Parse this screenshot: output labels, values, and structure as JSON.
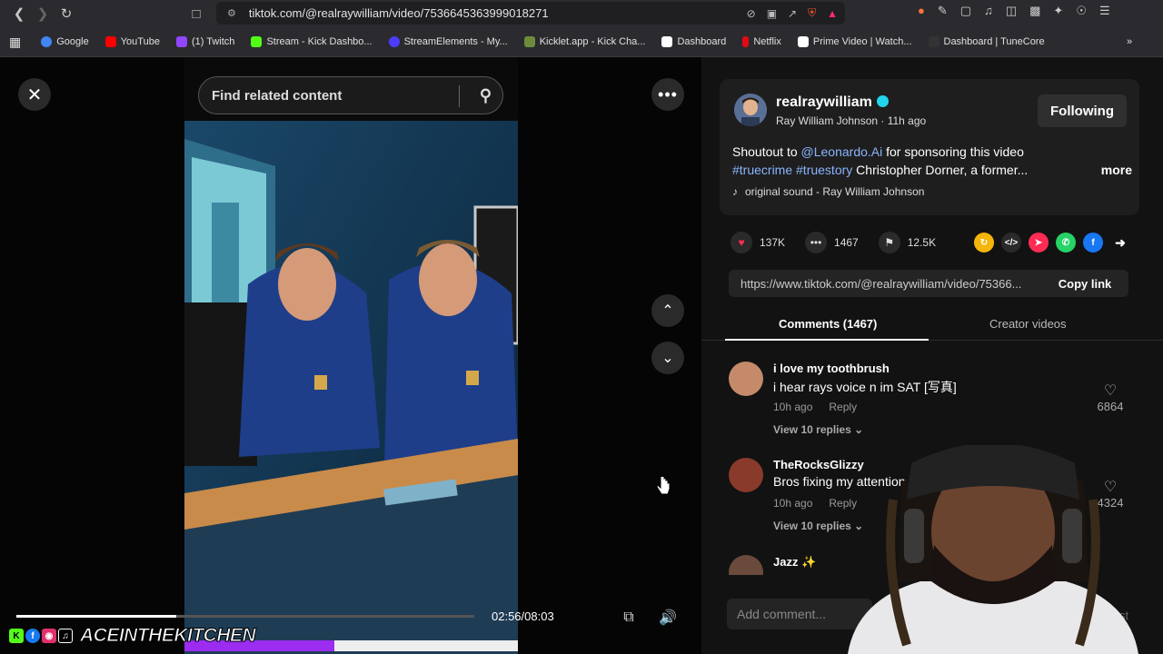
{
  "browser": {
    "url": "tiktok.com/@realraywilliam/video/7536645363999018271",
    "bookmarks": [
      {
        "label": "Google",
        "color": "#4285f4"
      },
      {
        "label": "YouTube",
        "color": "#ff0000"
      },
      {
        "label": "(1) Twitch",
        "color": "#9146ff"
      },
      {
        "label": "Stream - Kick Dashbo...",
        "color": "#53fc18"
      },
      {
        "label": "StreamElements - My...",
        "color": "#4b3cff"
      },
      {
        "label": "Kicklet.app - Kick Cha...",
        "color": "#6c8c3c"
      },
      {
        "label": "Dashboard",
        "color": "#ffffff"
      },
      {
        "label": "Netflix",
        "color": "#e50914"
      },
      {
        "label": "Prime Video | Watch...",
        "color": "#ffffff"
      },
      {
        "label": "Dashboard | TuneCore",
        "color": "#333333"
      }
    ]
  },
  "video": {
    "search_placeholder": "Find related content",
    "time": "02:56/08:03",
    "progress": 0.35,
    "stream_progress": 0.45
  },
  "overlay": {
    "channel_name": "ACEINTHEKITCHEN"
  },
  "post": {
    "username": "realraywilliam",
    "display_name": "Ray William Johnson",
    "time_ago": "11h ago",
    "follow_label": "Following",
    "desc_prefix": "Shoutout to ",
    "mention": "@Leonardo.Ai",
    "desc_mid": " for sponsoring this video",
    "hashtags": "#truecrime #truestory",
    "desc_tail": " Christopher Dorner, a former...",
    "more_label": "more",
    "sound": "original sound - Ray William Johnson",
    "likes": "137K",
    "comments": "1467",
    "saves": "12.5K",
    "link": "https://www.tiktok.com/@realraywilliam/video/75366...",
    "copy_label": "Copy link"
  },
  "tabs": {
    "comments": "Comments (1467)",
    "creator_videos": "Creator videos"
  },
  "comments": [
    {
      "user": "i love my toothbrush",
      "text": "i hear rays voice n im SAT [写真]",
      "time": "10h ago",
      "reply": "Reply",
      "replies": "View 10 replies ⌄",
      "likes": "6864"
    },
    {
      "user": "TheRocksGlizzy",
      "text": "Bros fixing my attention s",
      "time": "10h ago",
      "reply": "Reply",
      "replies": "View 10 replies ⌄",
      "likes": "4324"
    },
    {
      "user": "Jazz ✨",
      "text": "",
      "time": "",
      "reply": "",
      "replies": "",
      "likes": ""
    }
  ],
  "composer": {
    "placeholder": "Add comment...",
    "post_label": "st"
  },
  "colors": {
    "accent": "#fe2c55",
    "link": "#8ab4ff",
    "verified": "#20d5ec",
    "stream_bar": "#9b2cf0"
  }
}
